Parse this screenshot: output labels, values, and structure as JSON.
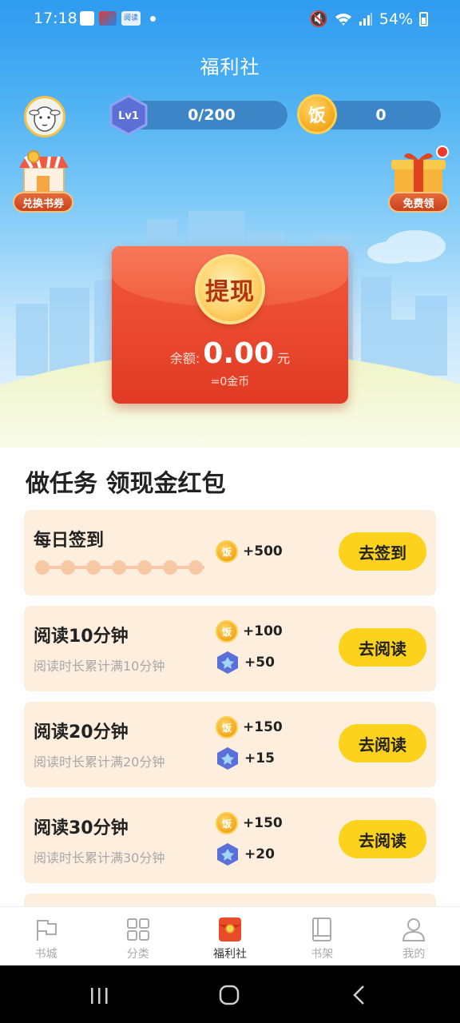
{
  "status_bar": {
    "time": "17:18",
    "app_badge": "阅读",
    "battery": "54%"
  },
  "header": {
    "title": "福利社",
    "level": "Lv1",
    "level_progress": "0/200",
    "coin_symbol": "饭",
    "coin_count": "0"
  },
  "widgets": {
    "exchange_label": "兑换书券",
    "free_label": "免费领"
  },
  "envelope": {
    "button_label": "提现",
    "balance_label": "余额:",
    "balance_value": "0.00",
    "balance_unit": "元",
    "balance_sub": "=0金币"
  },
  "tasks": {
    "section_title": "做任务 领现金红包",
    "items": [
      {
        "title": "每日签到",
        "subtitle": "",
        "coin_symbol": "饭",
        "coin_reward": "+500",
        "gem_reward": "",
        "button": "去签到"
      },
      {
        "title": "阅读10分钟",
        "subtitle": "阅读时长累计满10分钟",
        "coin_symbol": "饭",
        "coin_reward": "+100",
        "gem_reward": "+50",
        "button": "去阅读"
      },
      {
        "title": "阅读20分钟",
        "subtitle": "阅读时长累计满20分钟",
        "coin_symbol": "饭",
        "coin_reward": "+150",
        "gem_reward": "+15",
        "button": "去阅读"
      },
      {
        "title": "阅读30分钟",
        "subtitle": "阅读时长累计满30分钟",
        "coin_symbol": "饭",
        "coin_reward": "+150",
        "gem_reward": "+20",
        "button": "去阅读"
      }
    ]
  },
  "bottom_nav": {
    "items": [
      {
        "label": "书城",
        "icon": "flag-icon"
      },
      {
        "label": "分类",
        "icon": "grid-icon"
      },
      {
        "label": "福利社",
        "icon": "red-envelope-icon"
      },
      {
        "label": "书架",
        "icon": "book-icon"
      },
      {
        "label": "我的",
        "icon": "person-icon"
      }
    ],
    "active": "福利社"
  },
  "colors": {
    "accent_yellow": "#fcd21c",
    "envelope_red": "#e13a24",
    "card_bg": "#fdeede",
    "sky_blue": "#2f9bf0"
  }
}
